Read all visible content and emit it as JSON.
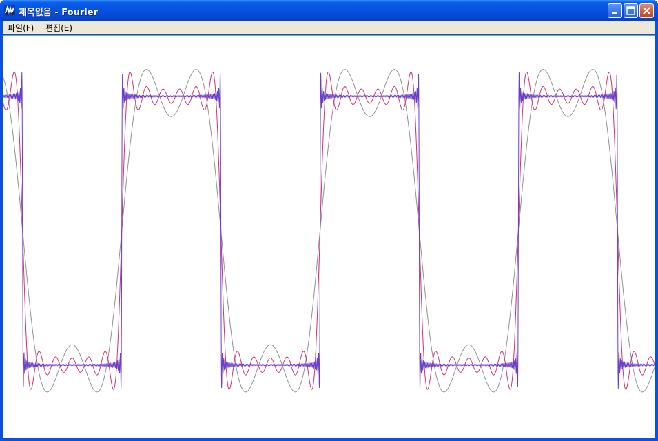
{
  "window": {
    "title": "제목없음 - Fourier",
    "icon": "fourier-app-icon"
  },
  "title_buttons": [
    "minimize-icon",
    "maximize-icon",
    "close-icon"
  ],
  "menu": {
    "items": [
      {
        "label": "파일(F)"
      },
      {
        "label": "편집(E)"
      }
    ]
  },
  "chart_data": {
    "type": "line",
    "x_periods": [
      -0.6,
      2.69
    ],
    "y_range": [
      -1.55,
      1.45
    ],
    "series": [
      {
        "harmonics": 2,
        "color": "#909090"
      },
      {
        "harmonics": 6,
        "color": "#d0307a"
      },
      {
        "harmonics": 70,
        "color": "#6a3fc8"
      }
    ]
  }
}
